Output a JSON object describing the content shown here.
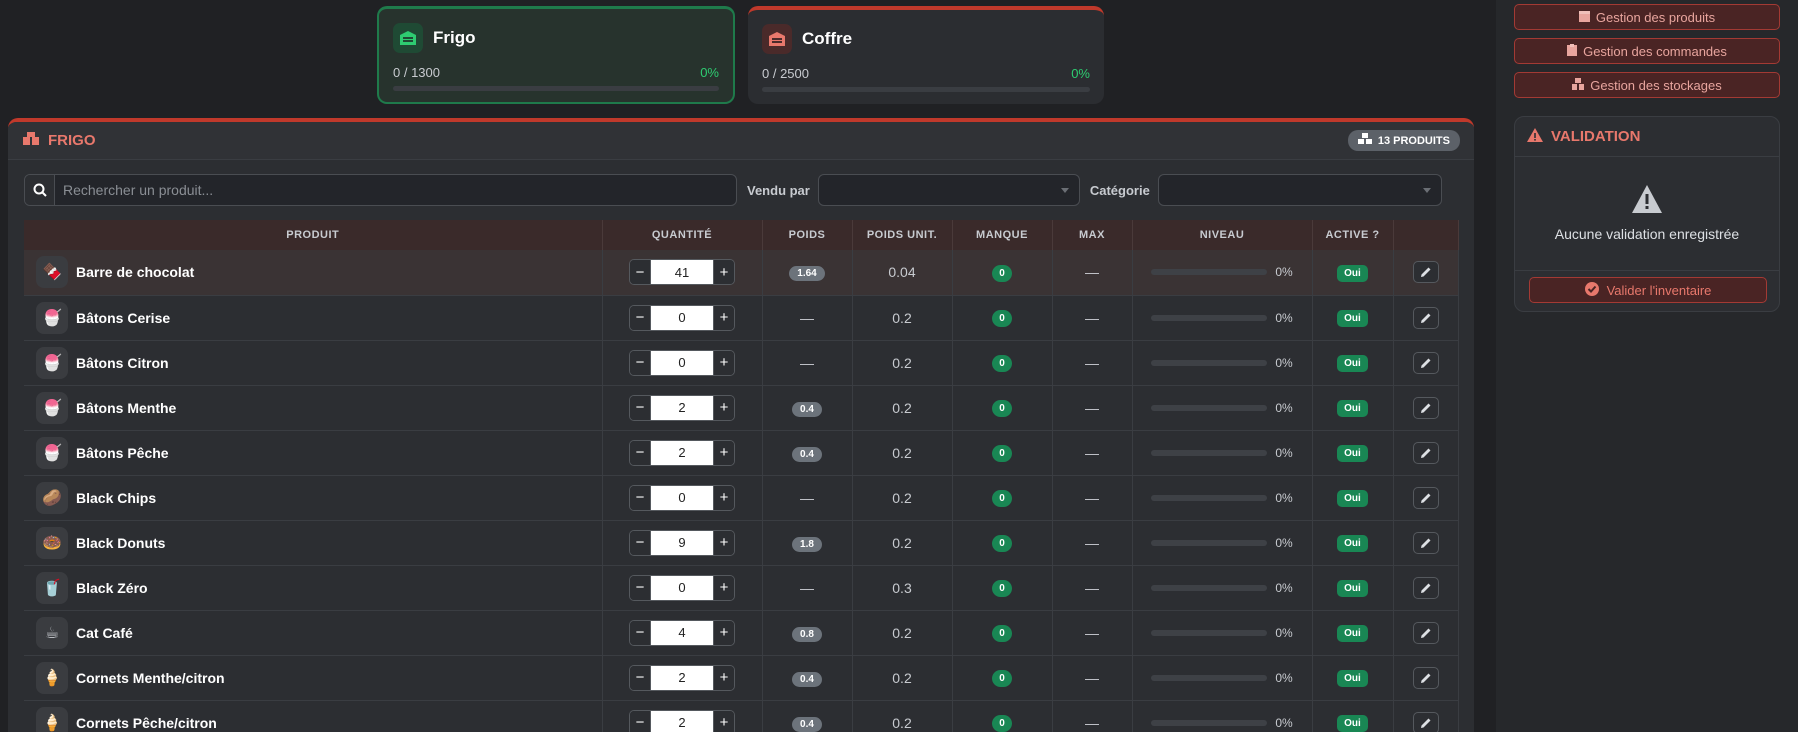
{
  "storages": {
    "frigo": {
      "name": "Frigo",
      "usage": "0 / 1300",
      "percent": "0%"
    },
    "coffre": {
      "name": "Coffre",
      "usage": "0 / 2500",
      "percent": "0%"
    }
  },
  "panel": {
    "title": "FRIGO",
    "count_badge": "13 PRODUITS"
  },
  "filters": {
    "search_placeholder": "Rechercher un produit...",
    "sold_by_label": "Vendu par",
    "category_label": "Catégorie"
  },
  "table": {
    "headers": [
      "PRODUIT",
      "QUANTITÉ",
      "POIDS",
      "POIDS UNIT.",
      "MANQUE",
      "MAX",
      "NIVEAU",
      "ACTIVE ?",
      ""
    ],
    "rows": [
      {
        "name": "Barre de chocolat",
        "icon": "🍫",
        "qty": "41",
        "poids": "1.64",
        "unit": "0.04",
        "manque": "0",
        "max": "—",
        "niveau": "0%",
        "active": "Oui"
      },
      {
        "name": "Bâtons Cerise",
        "icon": "🍧",
        "qty": "0",
        "poids": "—",
        "unit": "0.2",
        "manque": "0",
        "max": "—",
        "niveau": "0%",
        "active": "Oui"
      },
      {
        "name": "Bâtons Citron",
        "icon": "🍧",
        "qty": "0",
        "poids": "—",
        "unit": "0.2",
        "manque": "0",
        "max": "—",
        "niveau": "0%",
        "active": "Oui"
      },
      {
        "name": "Bâtons Menthe",
        "icon": "🍧",
        "qty": "2",
        "poids": "0.4",
        "unit": "0.2",
        "manque": "0",
        "max": "—",
        "niveau": "0%",
        "active": "Oui"
      },
      {
        "name": "Bâtons Pêche",
        "icon": "🍧",
        "qty": "2",
        "poids": "0.4",
        "unit": "0.2",
        "manque": "0",
        "max": "—",
        "niveau": "0%",
        "active": "Oui"
      },
      {
        "name": "Black Chips",
        "icon": "🥔",
        "qty": "0",
        "poids": "—",
        "unit": "0.2",
        "manque": "0",
        "max": "—",
        "niveau": "0%",
        "active": "Oui"
      },
      {
        "name": "Black Donuts",
        "icon": "🍩",
        "qty": "9",
        "poids": "1.8",
        "unit": "0.2",
        "manque": "0",
        "max": "—",
        "niveau": "0%",
        "active": "Oui"
      },
      {
        "name": "Black Zéro",
        "icon": "🥤",
        "qty": "0",
        "poids": "—",
        "unit": "0.3",
        "manque": "0",
        "max": "—",
        "niveau": "0%",
        "active": "Oui"
      },
      {
        "name": "Cat Café",
        "icon": "☕",
        "qty": "4",
        "poids": "0.8",
        "unit": "0.2",
        "manque": "0",
        "max": "—",
        "niveau": "0%",
        "active": "Oui"
      },
      {
        "name": "Cornets Menthe/citron",
        "icon": "🍦",
        "qty": "2",
        "poids": "0.4",
        "unit": "0.2",
        "manque": "0",
        "max": "—",
        "niveau": "0%",
        "active": "Oui"
      },
      {
        "name": "Cornets Pêche/citron",
        "icon": "🍦",
        "qty": "2",
        "poids": "0.4",
        "unit": "0.2",
        "manque": "0",
        "max": "—",
        "niveau": "0%",
        "active": "Oui"
      }
    ]
  },
  "sidebar": {
    "buttons": [
      "Gestion des produits",
      "Gestion des commandes",
      "Gestion des stockages"
    ]
  },
  "validation": {
    "title": "VALIDATION",
    "empty_text": "Aucune validation enregistrée",
    "button_label": "Valider l'inventaire"
  },
  "colors": {
    "accent_red": "#c0392b",
    "success_green": "#198754",
    "frigo_green": "#1f7a4b"
  }
}
